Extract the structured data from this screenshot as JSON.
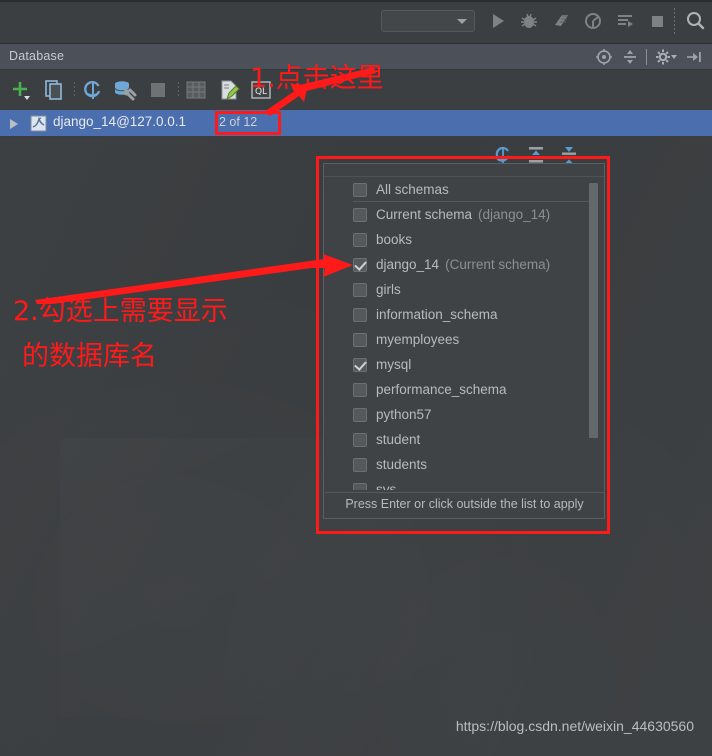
{
  "window": {
    "background_color": "#3b3e40"
  },
  "top_toolbar": {
    "run_config_value": "",
    "icons": [
      {
        "name": "run-icon",
        "glyph": "run"
      },
      {
        "name": "debug-icon",
        "glyph": "bug"
      },
      {
        "name": "coverage-icon",
        "glyph": "coverage"
      },
      {
        "name": "profile-icon",
        "glyph": "profile"
      },
      {
        "name": "attach-icon",
        "glyph": "attach"
      },
      {
        "name": "stop-icon",
        "glyph": "stop"
      },
      {
        "name": "search-icon",
        "glyph": "magnifier"
      }
    ]
  },
  "db_panel": {
    "title": "Database",
    "header_icons": [
      {
        "name": "locate-icon",
        "glyph": "target"
      },
      {
        "name": "collapse-all-icon",
        "glyph": "collapse"
      },
      {
        "name": "settings-gear-icon",
        "glyph": "gear"
      },
      {
        "name": "hide-panel-icon",
        "glyph": "hide"
      }
    ],
    "toolbar_icons": [
      {
        "name": "add-data-source-icon",
        "glyph": "plus"
      },
      {
        "name": "duplicate-icon",
        "glyph": "copy"
      },
      {
        "name": "refresh-icon",
        "glyph": "sync"
      },
      {
        "name": "data-source-properties-icon",
        "glyph": "wrench"
      },
      {
        "name": "stop-icon",
        "glyph": "square"
      },
      {
        "name": "table-editor-icon",
        "glyph": "grid"
      },
      {
        "name": "modify-table-icon",
        "glyph": "edit-doc"
      },
      {
        "name": "jump-to-query-console-icon",
        "glyph": "ql"
      }
    ]
  },
  "tree": {
    "row_label": "django_14@127.0.0.1",
    "row_badge": "2 of 12",
    "expand_arrow": "▶",
    "row_icon": "mysql-datasource-icon",
    "row_selected_color": "#4b6eaf"
  },
  "popup": {
    "toolbar_icons": [
      {
        "name": "refresh-schemas-icon",
        "glyph": "sync-blue"
      },
      {
        "name": "collapse-selection-icon",
        "glyph": "collapse-blue"
      },
      {
        "name": "expand-selection-icon",
        "glyph": "expand-blue"
      }
    ],
    "items": [
      {
        "label": "All schemas",
        "sub": "",
        "checked": false,
        "separator_under": true
      },
      {
        "label": "Current schema",
        "sub": "(django_14)",
        "checked": false,
        "separator_under": false
      },
      {
        "label": "books",
        "sub": "",
        "checked": false,
        "separator_under": false
      },
      {
        "label": "django_14",
        "sub": "(Current schema)",
        "checked": true,
        "separator_under": false
      },
      {
        "label": "girls",
        "sub": "",
        "checked": false,
        "separator_under": false
      },
      {
        "label": "information_schema",
        "sub": "",
        "checked": false,
        "separator_under": false
      },
      {
        "label": "myemployees",
        "sub": "",
        "checked": false,
        "separator_under": false
      },
      {
        "label": "mysql",
        "sub": "",
        "checked": true,
        "separator_under": false
      },
      {
        "label": "performance_schema",
        "sub": "",
        "checked": false,
        "separator_under": false
      },
      {
        "label": "python57",
        "sub": "",
        "checked": false,
        "separator_under": false
      },
      {
        "label": "student",
        "sub": "",
        "checked": false,
        "separator_under": false
      },
      {
        "label": "students",
        "sub": "",
        "checked": false,
        "separator_under": false
      },
      {
        "label": "sys",
        "sub": "",
        "checked": false,
        "separator_under": false
      }
    ],
    "footer_hint": "Press Enter or click outside the list to apply"
  },
  "annotations": {
    "color": "#ff1a1a",
    "step1_text": "1.点击这里",
    "step2_line1": "2.勾选上需要显示",
    "step2_line2": "的数据库名"
  },
  "watermark": {
    "url": "https://blog.csdn.net/weixin_44630560"
  }
}
